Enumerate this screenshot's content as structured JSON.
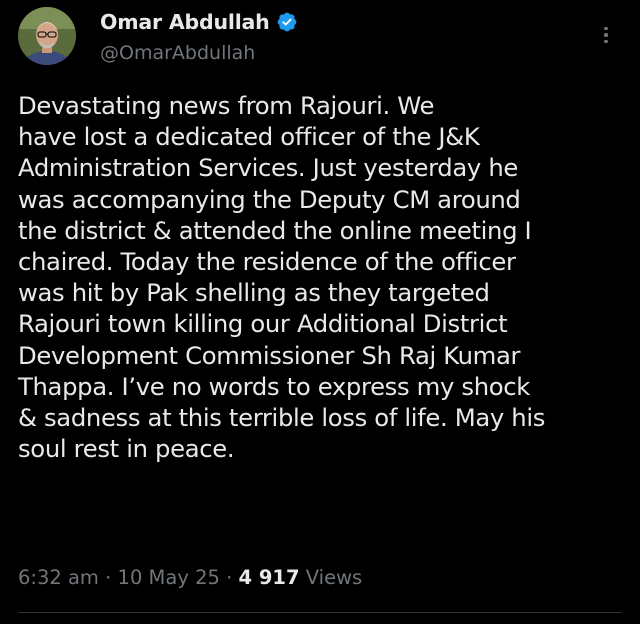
{
  "author": {
    "display_name": "Omar Abdullah",
    "handle": "@OmarAbdullah",
    "avatar_icon": "profile-photo",
    "verified": true,
    "verified_color": "#1d9bf0"
  },
  "tweet": {
    "lines": [
      "Devastating news from Rajouri. We",
      "have lost a dedicated officer of the J&K",
      "Administration Services. Just yesterday he",
      "was accompanying the Deputy CM around",
      "the district & attended the online meeting I",
      "chaired. Today the residence of the officer",
      "was hit by Pak shelling as they targeted",
      "Rajouri town killing our Additional District",
      "Development Commissioner Sh Raj Kumar",
      "Thappa. I’ve no words to express my shock",
      "& sadness at this terrible loss of life. May his",
      "soul rest in peace."
    ]
  },
  "meta": {
    "time": "6:32 am",
    "separator": " · ",
    "date": "10 May 25",
    "views_count": "4 917",
    "views_label": " Views"
  },
  "theme": {
    "background": "#000000",
    "text": "#e7e9ea",
    "secondary_text": "#71767b",
    "divider": "#2f3336"
  }
}
